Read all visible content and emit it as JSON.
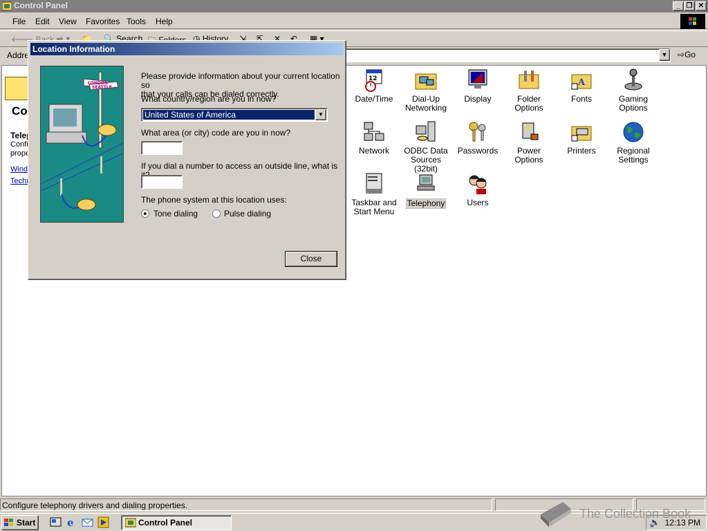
{
  "window": {
    "title": "Control Panel"
  },
  "menus": [
    "File",
    "Edit",
    "View",
    "Favorites",
    "Tools",
    "Help"
  ],
  "toolbar": {
    "back": "Back",
    "search": "Search",
    "folders": "Folders",
    "history": "History"
  },
  "address": {
    "label": "Addre",
    "go": "Go"
  },
  "panel": {
    "title": "Con",
    "subtitle": "Telep",
    "desc_line1": "Confi",
    "desc_line2": "prope",
    "link1": "Windo",
    "link2": "Techn"
  },
  "items": [
    {
      "line1": "Date/Time",
      "line2": ""
    },
    {
      "line1": "Dial-Up",
      "line2": "Networking"
    },
    {
      "line1": "Display",
      "line2": ""
    },
    {
      "line1": "Folder Options",
      "line2": ""
    },
    {
      "line1": "Fonts",
      "line2": ""
    },
    {
      "line1": "Gaming",
      "line2": "Options"
    },
    {
      "line1": "Network",
      "line2": ""
    },
    {
      "line1": "ODBC Data",
      "line2": "Sources (32bit)"
    },
    {
      "line1": "Passwords",
      "line2": ""
    },
    {
      "line1": "Power Options",
      "line2": ""
    },
    {
      "line1": "Printers",
      "line2": ""
    },
    {
      "line1": "Regional",
      "line2": "Settings"
    },
    {
      "line1": "Taskbar and",
      "line2": "Start Menu"
    },
    {
      "line1": "Telephony",
      "line2": ""
    },
    {
      "line1": "Users",
      "line2": ""
    }
  ],
  "status": {
    "text": "Configure telephony drivers and dialing properties."
  },
  "taskbar": {
    "start": "Start",
    "task": "Control Panel",
    "time": "12:13 PM"
  },
  "watermark": "The Collection Book",
  "dialog": {
    "title": "Location Information",
    "intro_line1": "Please provide information about your current location so",
    "intro_line2": "that your calls can be dialed correctly.",
    "country_label": "What country/region are you in now?",
    "country_value": "United States of America",
    "area_label": "What area (or city) code are you in now?",
    "area_value": "",
    "outside_label": "If you dial a number to access an outside line, what is it?",
    "outside_value": "",
    "phone_system_label": "The phone system at this location uses:",
    "tone": "Tone dialing",
    "pulse": "Pulse dialing",
    "selected_dialing": "tone",
    "close": "Close",
    "sign_london": "LONDON",
    "sign_seattle": "SEATTLE"
  }
}
